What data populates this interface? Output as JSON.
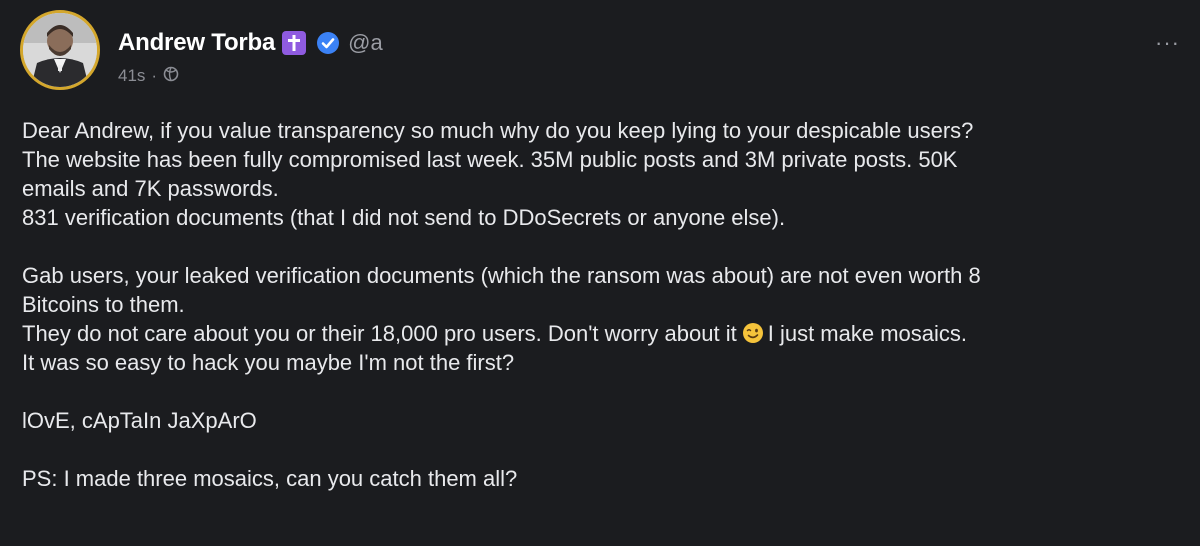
{
  "post": {
    "author_name": "Andrew Torba",
    "handle": "@a",
    "timestamp": "41s",
    "more_label": "···",
    "badge_colors": {
      "cross": "#8f5be0",
      "verified": "#3b82f6",
      "avatar_ring": "#d4a72c"
    },
    "icons": [
      "cross-badge-icon",
      "verified-check-icon",
      "globe-icon",
      "more-options-icon",
      "winking-face-emoji-icon"
    ],
    "lines": {
      "l1": "Dear Andrew, if you value transparency so much why do you keep lying to your despicable users?",
      "l2": "The website has been fully compromised last week. 35M public posts and 3M private posts. 50K",
      "l3": "emails and 7K passwords.",
      "l4": "831 verification documents (that I did not send to DDoSecrets or anyone else).",
      "l5": "Gab users, your leaked verification documents (which the ransom was about) are not even worth 8",
      "l6": "Bitcoins to them.",
      "l7a": "They do not care about you or their 18,000 pro users. Don't worry about it",
      "l7b": "I just make mosaics.",
      "l8": "It was so easy to hack you maybe I'm not the first?",
      "l9": "lOvE, cApTaIn JaXpArO",
      "l10": "PS: I made three mosaics, can you catch them all?"
    }
  }
}
